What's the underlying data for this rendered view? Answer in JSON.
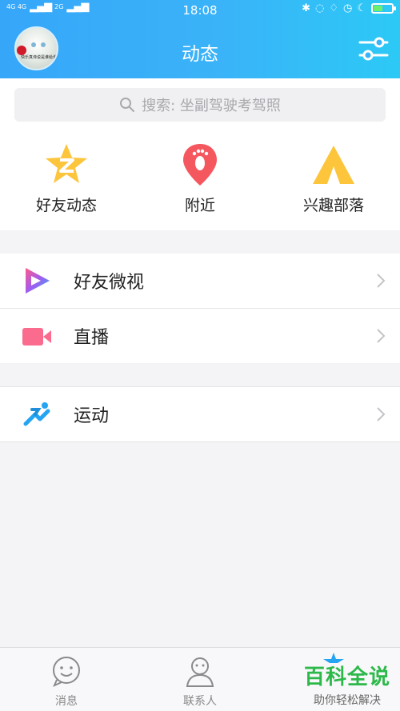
{
  "status_bar": {
    "network_left": "4G 4G",
    "network_right": "2G",
    "time": "18:08",
    "battery_percent": 50
  },
  "header": {
    "title": "动态",
    "avatar_caption": "快乐真谛说是谁给谁"
  },
  "search": {
    "placeholder": "搜索: 坐副驾驶考驾照"
  },
  "quick_actions": [
    {
      "label": "好友动态",
      "icon": "qzone-star-icon"
    },
    {
      "label": "附近",
      "icon": "footprint-pin-icon"
    },
    {
      "label": "兴趣部落",
      "icon": "tent-icon"
    }
  ],
  "list1": [
    {
      "label": "好友微视",
      "icon": "weishi-play-icon"
    },
    {
      "label": "直播",
      "icon": "video-camera-icon"
    }
  ],
  "list2": [
    {
      "label": "运动",
      "icon": "running-icon"
    }
  ],
  "tabbar": [
    {
      "label": "消息",
      "icon": "chat-bubble-icon"
    },
    {
      "label": "联系人",
      "icon": "contacts-person-icon"
    }
  ],
  "watermark": {
    "line1": "百科全说",
    "line2": "助你轻松解决"
  },
  "colors": {
    "header_start": "#36a6f9",
    "header_end": "#2cc9f6",
    "qzone_yellow": "#fcc53c",
    "nearby_red": "#f5575e",
    "tent_yellow": "#fcc53c",
    "live_pink": "#fb6b8e",
    "sport_blue": "#25a4f2",
    "watermark_green": "#2db84a"
  }
}
